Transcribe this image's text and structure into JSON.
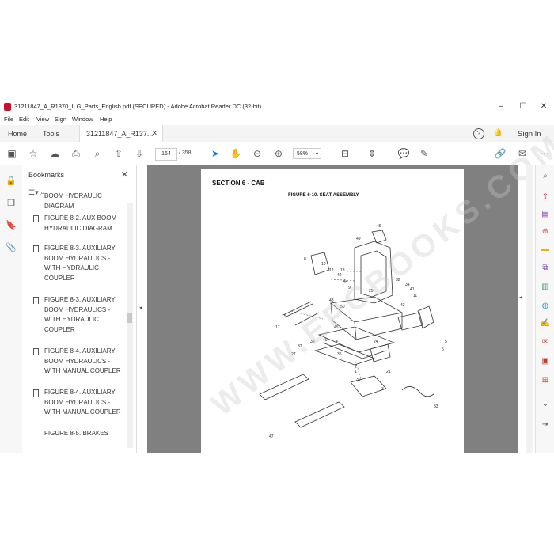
{
  "window": {
    "title": "31211847_A_R1370_ILG_Parts_English.pdf (SECURED) - Adobe Acrobat Reader DC (32-bit)"
  },
  "menu": [
    "File",
    "Edit",
    "View",
    "Sign",
    "Window",
    "Help"
  ],
  "tabs": {
    "home": "Home",
    "tools": "Tools",
    "document": "31211847_A_R137...",
    "sign_in": "Sign In"
  },
  "toolbar": {
    "page_current": "164",
    "page_total": "/ 358",
    "zoom": "58%"
  },
  "bookmarks": {
    "header": "Bookmarks",
    "items": [
      "BOOM HYDRAULIC DIAGRAM",
      "FIGURE 8-2. AUX BOOM HYDRAULIC DIAGRAM",
      "FIGURE 8-3. AUXILIARY BOOM HYDRAULICS - WITH HYDRAULIC COUPLER",
      "FIGURE 8-3. AUXILIARY BOOM HYDRAULICS - WITH HYDRAULIC COUPLER",
      "FIGURE 8-4. AUXILIARY BOOM HYDRAULICS - WITH MANUAL COUPLER",
      "FIGURE 8-4. AUXILIARY BOOM HYDRAULICS - WITH MANUAL COUPLER",
      "FIGURE 8-5. BRAKES"
    ]
  },
  "page": {
    "section": "SECTION 6 - CAB",
    "figure": "FIGURE 6-10. SEAT ASSEMBLY",
    "watermark": "WWW.EPCBOOKS.COM",
    "callouts": [
      "46",
      "49",
      "8",
      "10",
      "12",
      "13",
      "42",
      "44",
      "9",
      "32",
      "34",
      "41",
      "11",
      "48",
      "50",
      "45",
      "43",
      "25",
      "15",
      "17",
      "39",
      "40",
      "4",
      "2",
      "1",
      "30",
      "36",
      "37",
      "27",
      "24",
      "21",
      "3",
      "47",
      "33",
      "5",
      "6"
    ]
  },
  "colors": {
    "accent_red": "#c8102e",
    "viewer_bg": "#808080"
  }
}
